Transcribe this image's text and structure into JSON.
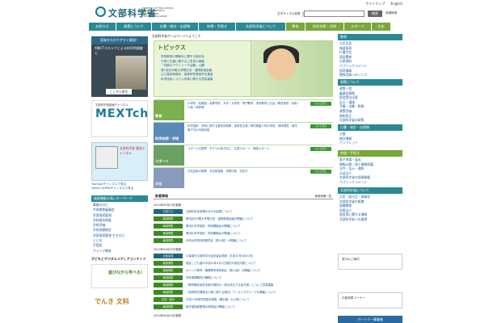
{
  "header": {
    "logo_jp": "文部科学省",
    "logo_en": "MINISTRY OF EDUCATION, CULTURE, SPORTS, SCIENCE AND TECHNOLOGY-JAPAN",
    "top_links": [
      "サイトマップ",
      "English"
    ],
    "size_label": "文字サイズの変更",
    "size_small": "中",
    "size_large": "大",
    "search_button": "検索",
    "advanced_search": "詳細検索"
  },
  "nav": {
    "items": [
      {
        "label": "お知らせ",
        "color": "teal"
      },
      {
        "label": "政策について",
        "color": "teal"
      },
      {
        "label": "白書・統計・出版物",
        "color": "teal"
      },
      {
        "label": "申請・手続き",
        "color": "teal"
      },
      {
        "label": "文部科学省について",
        "color": "teal"
      },
      {
        "label": "教育",
        "color": "green"
      },
      {
        "label": "科学技術・学術",
        "color": "green"
      },
      {
        "label": "スポーツ",
        "color": "green"
      },
      {
        "label": "文化",
        "color": "green"
      }
    ]
  },
  "breadcrumb": "文部科学省ホームページへようこそ",
  "left": {
    "banner1_cap": "家族をわかりやすく解説！",
    "banner1_text": "X線CTスキャナによる科学的調査と",
    "banner1_btn": "ここから再生",
    "mext_small": "文部科学省動画チャンネル",
    "mext": "MEXTch",
    "tv_text": "文部科学省 動画チャンネル",
    "yt_links": [
      "YouTubeチャンネルで見る",
      "Yahoo! JAPANチャンネルで見る"
    ],
    "section_heading": "検索機能の高いキーワード",
    "links": [
      "事業仕分け",
      "中央教育審議会",
      "学習指導要領",
      "学校基本調査",
      "学校評価",
      "学校保健統計",
      "学習指導要領 生きる力",
      "いじめ",
      "不登校",
      "キャリア教育",
      "奨学金"
    ],
    "kids_title": "子どもとデジタルメディアコンテンツ",
    "kids_box": "遊びながら学べる！",
    "kids_box2": "でんき 文科"
  },
  "topics": {
    "title": "トピックス",
    "items": [
      "学校教員の情報化に関する検討会",
      "子育て支援に関するご意見の募集",
      "『内国のアウトリーチ活動』公開",
      "第1回日中韓大学間交流・連携推進会議",
      "公立高校無償化・高等学校等就学支援金",
      "科学技術システム改革に関する意見募集"
    ]
  },
  "categories": [
    {
      "label": "教育",
      "color": "#5a9a30",
      "links": "小学校・幼稚園・高等学校　大学・大学院・専門教育　学校教育と社会 / 教員免許・採用・人事・研修等",
      "more": "もっと見る"
    },
    {
      "label": "科学技術・学術",
      "color": "#2a7aa8",
      "links": "科学技術・学術に関する基本的政策　放射性元素 / 研究基盤人材の育成　地球環境・海洋　原子力の平和利用",
      "more": "もっと見る"
    },
    {
      "label": "スポーツ",
      "color": "#3a8a40",
      "links": "スポーツの振興　子どもの体力向上　生涯スポーツ　競技スポーツ",
      "more": "もっと見る"
    },
    {
      "label": "文化",
      "color": "#6a7aa0",
      "links": "文化芸術の振興　文化財保護　宗務行政　文化庁",
      "more": "もっと見る"
    }
  ],
  "news": {
    "title": "新着情報",
    "links": "新着情報一覧",
    "date1": "2010年04月23日更新",
    "rows1": [
      {
        "tag": "お知らせ",
        "tag_color": "t",
        "text": "文部科学省事業仕分けの結果について"
      },
      {
        "tag": "報道発表",
        "tag_color": "g",
        "text": "第3回日中韓大学間交流・連携推進会議の開催について"
      },
      {
        "tag": "報道発表",
        "tag_color": "g",
        "text": "第3回 科学技術・学術審議会の開催について"
      },
      {
        "tag": "報道発表",
        "tag_color": "g",
        "text": "第5回 科学技術・学術審議会の開催について"
      },
      {
        "tag": "報道発表",
        "tag_color": "g",
        "text": "法科大学院特別委員会（第34回）の開催について"
      }
    ],
    "date2": "2010年04月22日更新",
    "rows2": [
      {
        "tag": "大臣会見",
        "tag_color": "t",
        "text": "川端達夫文部科学大臣記者会見録（平成22年4月20日）"
      },
      {
        "tag": "報道発表",
        "tag_color": "g",
        "text": "認定こども園の平成22年4月1日現在の認定件数について"
      },
      {
        "tag": "報道発表",
        "tag_color": "g",
        "text": "キャリア教育・職業教育特別部会（第14回）の開催について"
      },
      {
        "tag": "報道発表",
        "tag_color": "g",
        "text": "学校事務職員の職務について"
      },
      {
        "tag": "報道発表",
        "tag_color": "g",
        "text": "「教育職員免許法施行規則の一部を改正する省令案」について意見募集"
      },
      {
        "tag": "報道発表",
        "tag_color": "g",
        "text": "「政府研究開発法人等に関する検討」ワーキンググループの開催について"
      },
      {
        "tag": "白書・統計",
        "tag_color": "g",
        "text": "平成21年度学校基本調査（確定値）の公表について"
      },
      {
        "tag": "報道発表",
        "tag_color": "g",
        "text": "新学習指導要領の説明会の開催について"
      }
    ],
    "date3": "2010年04月19日更新"
  },
  "right": {
    "hd1": "教育",
    "list1": [
      "大臣会見",
      "報道発表",
      "行事予定",
      "国会関係",
      "公表資料",
      "パブリックコメント",
      "採用情報",
      "関係団体へのリンク"
    ],
    "hd2": "政策について",
    "list2": [
      "政策一覧",
      "審議会情報",
      "国会提出法案",
      "告示・通達",
      "予算・決算・財務",
      "政策評価",
      "税制改正",
      "文部科学省の政策"
    ],
    "hd3": "白書・統計・出版物",
    "list3": [
      "白書",
      "統計情報",
      "パンフレット"
    ],
    "hd4": "申請・手続き",
    "list4": [
      "電子申請・届出",
      "情報公開・個人情報保護",
      "法令・告示・通知",
      "公益法人",
      "文部科学省の調達情報",
      "パブリックコメント"
    ],
    "hd5": "文部科学省について",
    "list5": [
      "大臣・副大臣・政務官",
      "文部科学省の組織",
      "組織関係",
      "所管法人",
      "国会等に関する情報",
      "文部科学省への要望"
    ],
    "banner1": "窓口のご案内",
    "banner2": "行政改革コーナー",
    "blue_btn": "パートナー事業者"
  }
}
